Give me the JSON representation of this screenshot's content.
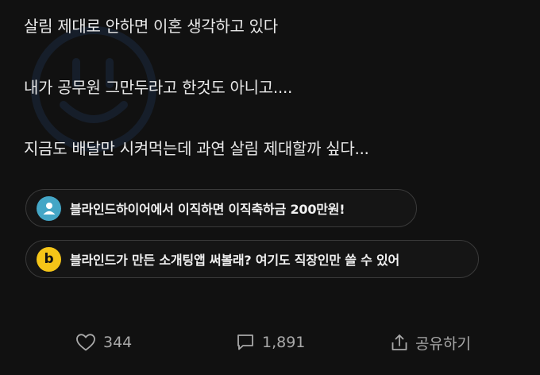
{
  "post": {
    "paragraphs": [
      "살림 제대로 안하면 이혼 생각하고 있다",
      "내가 공무원 그만두라고 한것도 아니고....",
      "지금도 배달만 시켜먹는데 과연 살림 제대할까 싶다..."
    ]
  },
  "promos": [
    {
      "text": "블라인드하이어에서 이직하면 이직축하금 200만원!",
      "icon": "person-icon",
      "color": "#44a6c6"
    },
    {
      "text": "블라인드가 만든 소개팅앱 써볼래? 여기도 직장인만 쓸 수 있어",
      "icon": "b-logo-icon",
      "icon_letter": "b",
      "color": "#f5c518"
    }
  ],
  "actions": {
    "like_count": "344",
    "comment_count": "1,891",
    "share_label": "공유하기"
  }
}
